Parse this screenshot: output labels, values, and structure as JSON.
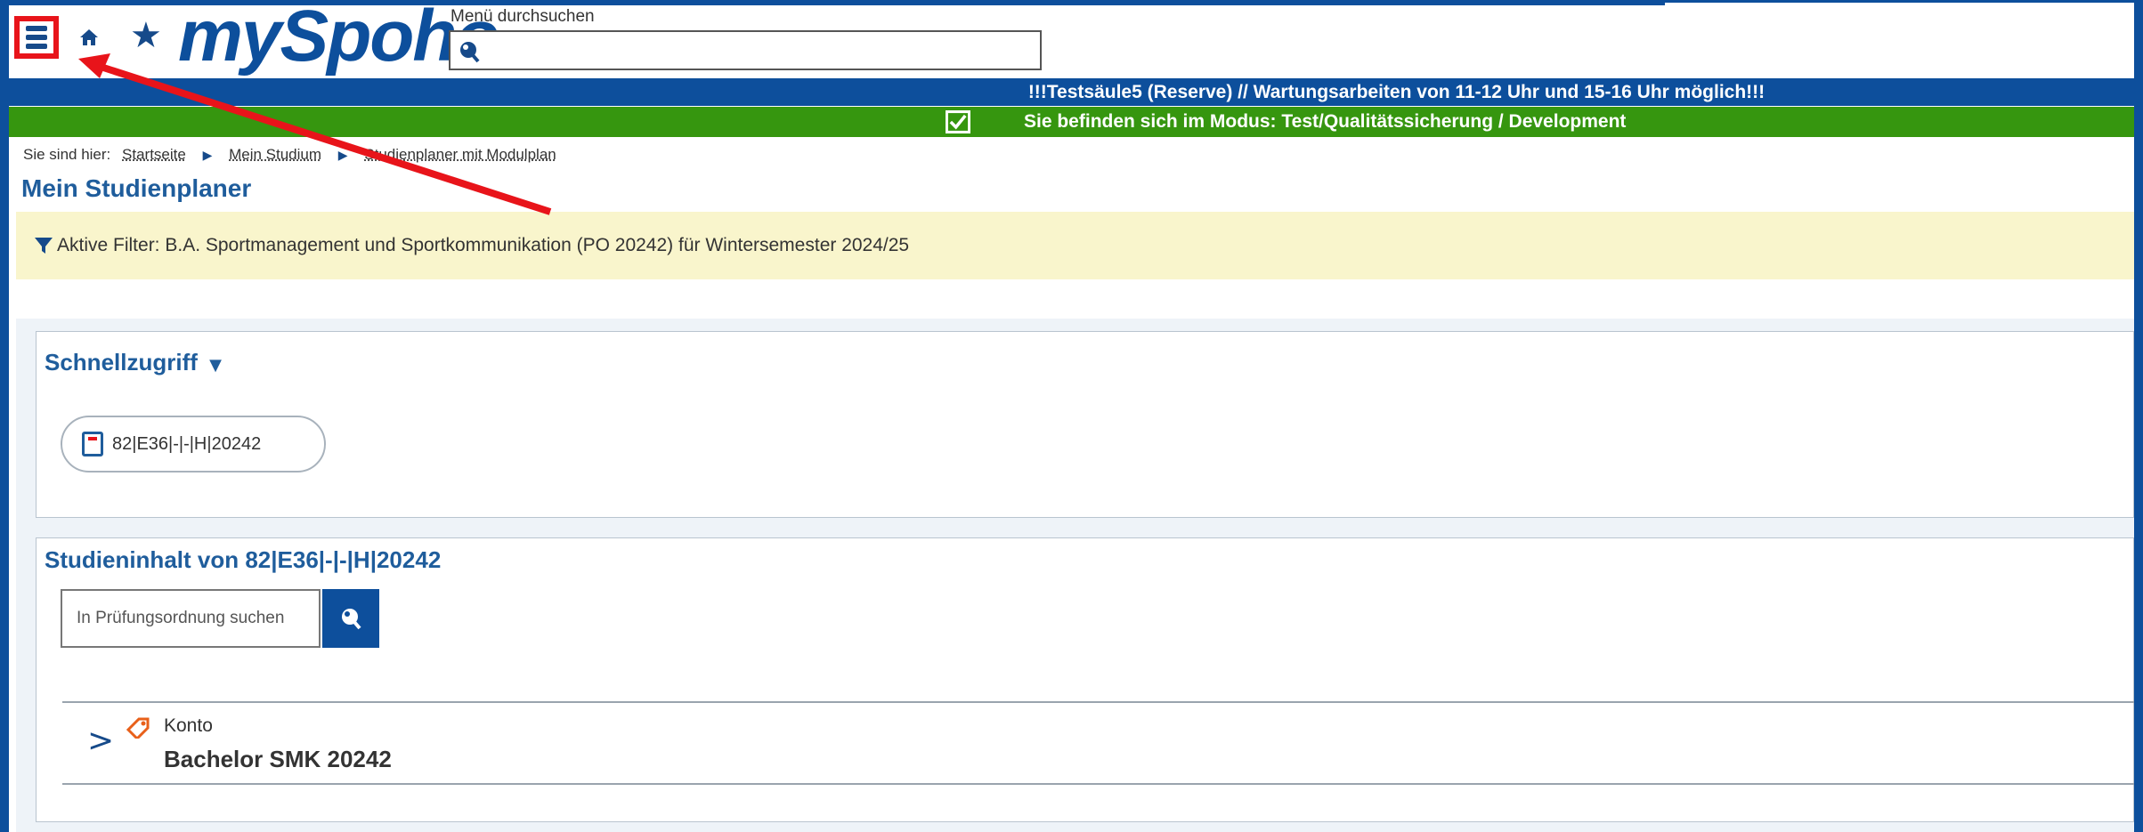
{
  "header": {
    "logo": "mySpoho",
    "search_label": "Menü durchsuchen",
    "search_value": ""
  },
  "banners": {
    "maintenance": "!!!Testsäule5 (Reserve) // Wartungsarbeiten von 11-12 Uhr und 15-16 Uhr möglich!!!",
    "mode": "Sie befinden sich im Modus: Test/Qualitätssicherung / Development"
  },
  "breadcrumb": {
    "prefix": "Sie sind hier:",
    "items": [
      "Startseite",
      "Mein Studium",
      "Studienplaner mit Modulplan"
    ]
  },
  "page_title": "Mein Studienplaner",
  "filter": {
    "text": "Aktive Filter: B.A. Sportmanagement und Sportkommunikation (PO 20242) für Wintersemester 2024/25"
  },
  "schnellzugriff": {
    "title": "Schnellzugriff",
    "chip_label": "82|E36|-|-|H|20242"
  },
  "studieninhalt": {
    "title": "Studieninhalt von 82|E36|-|-|H|20242",
    "search_placeholder": "In Prüfungsordnung suchen",
    "tree": {
      "type_label": "Konto",
      "name": "Bachelor SMK 20242"
    }
  },
  "colors": {
    "brand_blue": "#0d4f9c",
    "mode_green": "#36960f",
    "filter_bg": "#f9f5cc",
    "highlight_red": "#e8141a"
  }
}
